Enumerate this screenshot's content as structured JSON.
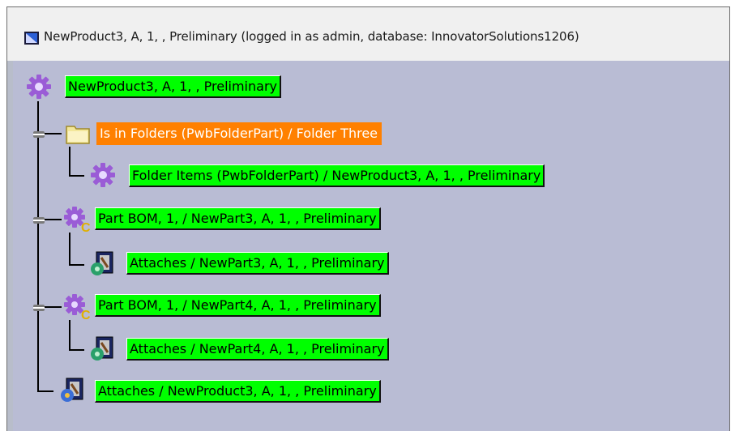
{
  "window": {
    "title": "NewProduct3, A, 1, , Preliminary (logged in as admin, database: InnovatorSolutions1206)"
  },
  "tree": {
    "root": {
      "label": "NewProduct3, A, 1, , Preliminary",
      "icon": "gear-icon",
      "color": "#00ff00"
    },
    "items": [
      {
        "label": "Is in Folders (PwbFolderPart) / Folder Three",
        "icon": "folder-icon",
        "color": "#ff8000"
      },
      {
        "label": "Folder Items (PwbFolderPart) / NewProduct3, A, 1, , Preliminary",
        "icon": "gear-icon",
        "color": "#00ff00"
      },
      {
        "label": "Part BOM, 1,  / NewPart3, A, 1, , Preliminary",
        "icon": "part-gear-icon",
        "color": "#00ff00"
      },
      {
        "label": "Attaches / NewPart3, A, 1, , Preliminary",
        "icon": "document-icon",
        "color": "#00ff00"
      },
      {
        "label": "Part BOM, 1,  / NewPart4, A, 1, , Preliminary",
        "icon": "part-gear-icon",
        "color": "#00ff00"
      },
      {
        "label": "Attaches / NewPart4, A, 1, , Preliminary",
        "icon": "document-icon",
        "color": "#00ff00"
      },
      {
        "label": "Attaches / NewProduct3, A, 1, , Preliminary",
        "icon": "document-icon",
        "color": "#00ff00"
      }
    ]
  }
}
